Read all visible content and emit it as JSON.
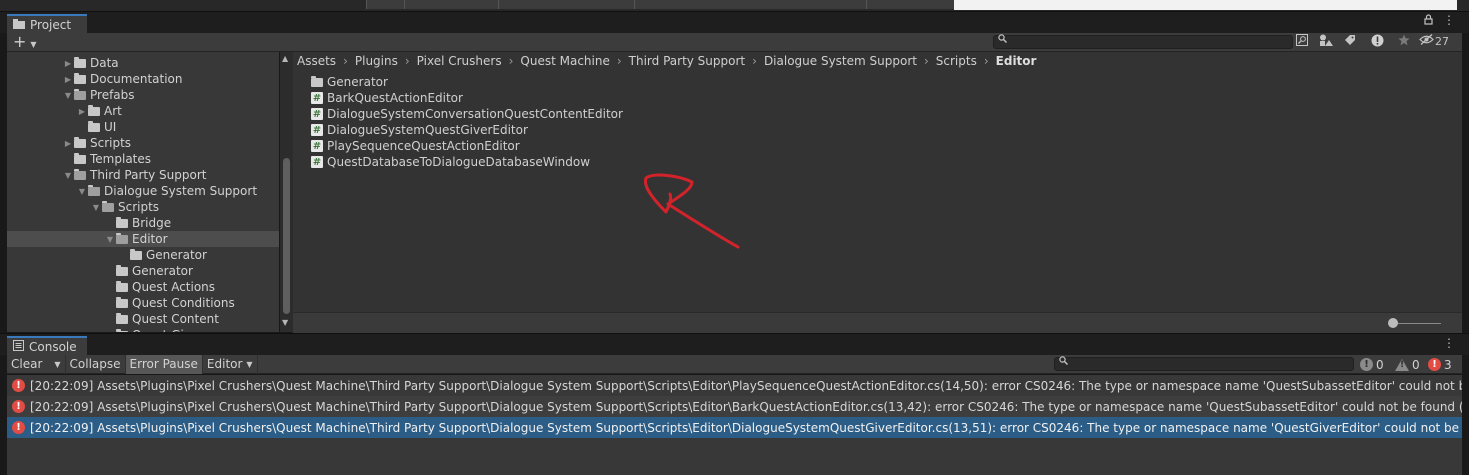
{
  "project": {
    "tab_label": "Project",
    "add_label": "+",
    "tree": [
      {
        "label": "Data",
        "depth": 4,
        "arrow": "right",
        "open": false
      },
      {
        "label": "Documentation",
        "depth": 4,
        "arrow": "right",
        "open": false
      },
      {
        "label": "Prefabs",
        "depth": 4,
        "arrow": "down",
        "open": true
      },
      {
        "label": "Art",
        "depth": 5,
        "arrow": "right",
        "open": false
      },
      {
        "label": "UI",
        "depth": 5,
        "arrow": "none",
        "open": false
      },
      {
        "label": "Scripts",
        "depth": 4,
        "arrow": "right",
        "open": false
      },
      {
        "label": "Templates",
        "depth": 4,
        "arrow": "none",
        "open": false
      },
      {
        "label": "Third Party Support",
        "depth": 4,
        "arrow": "down",
        "open": true
      },
      {
        "label": "Dialogue System Support",
        "depth": 5,
        "arrow": "down",
        "open": true
      },
      {
        "label": "Scripts",
        "depth": 6,
        "arrow": "down",
        "open": true
      },
      {
        "label": "Bridge",
        "depth": 7,
        "arrow": "none",
        "open": false
      },
      {
        "label": "Editor",
        "depth": 7,
        "arrow": "down",
        "open": true,
        "selected": true
      },
      {
        "label": "Generator",
        "depth": 8,
        "arrow": "none",
        "open": false
      },
      {
        "label": "Generator",
        "depth": 7,
        "arrow": "none",
        "open": false
      },
      {
        "label": "Quest Actions",
        "depth": 7,
        "arrow": "none",
        "open": false
      },
      {
        "label": "Quest Conditions",
        "depth": 7,
        "arrow": "none",
        "open": false
      },
      {
        "label": "Quest Content",
        "depth": 7,
        "arrow": "none",
        "open": false
      },
      {
        "label": "Quest Giver",
        "depth": 7,
        "arrow": "none",
        "open": false
      }
    ],
    "breadcrumb": [
      "Assets",
      "Plugins",
      "Pixel Crushers",
      "Quest Machine",
      "Third Party Support",
      "Dialogue System Support",
      "Scripts",
      "Editor"
    ],
    "files": [
      {
        "label": "Generator",
        "kind": "folder"
      },
      {
        "label": "BarkQuestActionEditor",
        "kind": "script"
      },
      {
        "label": "DialogueSystemConversationQuestContentEditor",
        "kind": "script"
      },
      {
        "label": "DialogueSystemQuestGiverEditor",
        "kind": "script"
      },
      {
        "label": "PlaySequenceQuestActionEditor",
        "kind": "script"
      },
      {
        "label": "QuestDatabaseToDialogueDatabaseWindow",
        "kind": "script"
      }
    ],
    "hidden_count": "27"
  },
  "console": {
    "tab_label": "Console",
    "clear_label": "Clear",
    "collapse_label": "Collapse",
    "error_pause_label": "Error Pause",
    "editor_label": "Editor",
    "log_count": "0",
    "warning_count": "0",
    "error_count": "3",
    "entries": [
      "[20:22:09] Assets\\Plugins\\Pixel Crushers\\Quest Machine\\Third Party Support\\Dialogue System Support\\Scripts\\Editor\\PlaySequenceQuestActionEditor.cs(14,50): error CS0246: The type or namespace name 'QuestSubassetEditor' could not be found (are you missing a using directive or an assembly reference?)",
      "[20:22:09] Assets\\Plugins\\Pixel Crushers\\Quest Machine\\Third Party Support\\Dialogue System Support\\Scripts\\Editor\\BarkQuestActionEditor.cs(13,42): error CS0246: The type or namespace name 'QuestSubassetEditor' could not be found (are you missing a using directive or an assembly reference?)",
      "[20:22:09] Assets\\Plugins\\Pixel Crushers\\Quest Machine\\Third Party Support\\Dialogue System Support\\Scripts\\Editor\\DialogueSystemQuestGiverEditor.cs(13,51): error CS0246: The type or namespace name 'QuestGiverEditor' could not be found (are you missing a using directive or an assembly reference?)"
    ]
  },
  "colors": {
    "accent_tab": "#3a79bb",
    "error_red": "#e14c45",
    "selected_row": "#2c5d87",
    "annotation_arrow": "#d3232a"
  }
}
